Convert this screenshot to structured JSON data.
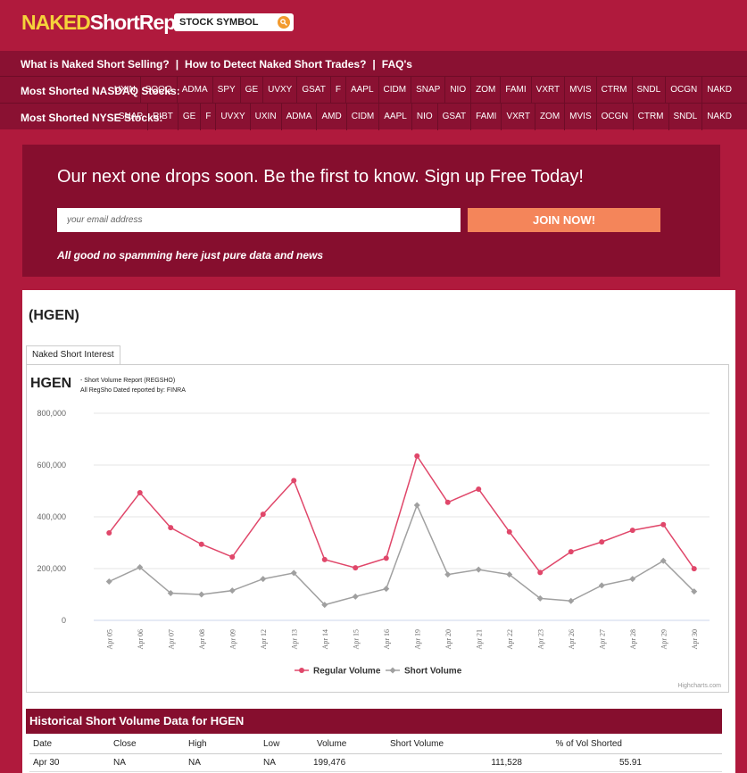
{
  "header": {
    "logo_naked": "NAKED",
    "logo_short": "ShortReport",
    "search_placeholder": "STOCK SYMBOL"
  },
  "nav": {
    "links": [
      "What is Naked Short Selling?",
      "How to Detect Naked Short Trades?",
      "FAQ's"
    ],
    "separator": "|",
    "nasdaq_label": "Most Shorted NASDAQ Stocks:",
    "nasdaq_tickers": [
      "UXIN",
      "SQQQ",
      "ADMA",
      "SPY",
      "GE",
      "UVXY",
      "GSAT",
      "F",
      "AAPL",
      "CIDM",
      "SNAP",
      "NIO",
      "ZOM",
      "FAMI",
      "VXRT",
      "MVIS",
      "CTRM",
      "SNDL",
      "OCGN",
      "NAKD"
    ],
    "nyse_label": "Most Shorted NYSE Stocks:",
    "nyse_tickers": [
      "SNAP",
      "RIBT",
      "GE",
      "F",
      "UVXY",
      "UXIN",
      "ADMA",
      "AMD",
      "CIDM",
      "AAPL",
      "NIO",
      "GSAT",
      "FAMI",
      "VXRT",
      "ZOM",
      "MVIS",
      "OCGN",
      "CTRM",
      "SNDL",
      "NAKD"
    ]
  },
  "signup": {
    "headline": "Our next one drops soon. Be the first to know. Sign up Free Today!",
    "email_placeholder": "your email address",
    "button": "JOIN NOW!",
    "note": "All good no spamming here just pure data and news"
  },
  "main": {
    "title": "(HGEN)",
    "tab": "Naked Short Interest",
    "chart_ticker": "HGEN",
    "chart_sub1": "- Short Volume Report  (REGSHO)",
    "chart_sub2": "All RegSho Dated reported by: FINRA",
    "credit": "Highcharts.com"
  },
  "colors": {
    "background": "#b01a3d",
    "nav": "#8a1132",
    "regular": "#e0476a",
    "short": "#a0a0a0",
    "join": "#f4855a"
  },
  "chart_data": {
    "type": "line",
    "categories": [
      "Apr 05",
      "Apr 06",
      "Apr 07",
      "Apr 08",
      "Apr 09",
      "Apr 12",
      "Apr 13",
      "Apr 14",
      "Apr 15",
      "Apr 16",
      "Apr 19",
      "Apr 20",
      "Apr 21",
      "Apr 22",
      "Apr 23",
      "Apr 26",
      "Apr 27",
      "Apr 28",
      "Apr 29",
      "Apr 30"
    ],
    "ylim": [
      0,
      800000
    ],
    "yticks": [
      0,
      200000,
      400000,
      600000,
      800000
    ],
    "ytick_labels": [
      "0",
      "200,000",
      "400,000",
      "600,000",
      "800,000"
    ],
    "series": [
      {
        "name": "Regular Volume",
        "color": "#e0476a",
        "values": [
          338000,
          493000,
          358000,
          294000,
          245000,
          410000,
          540000,
          235000,
          203000,
          240000,
          635000,
          456000,
          507000,
          342000,
          185000,
          265000,
          303000,
          348000,
          370000,
          199476
        ]
      },
      {
        "name": "Short Volume",
        "color": "#a0a0a0",
        "values": [
          150000,
          205000,
          105000,
          100000,
          115000,
          160000,
          183000,
          60000,
          92000,
          122000,
          445000,
          177000,
          196000,
          177000,
          85000,
          75000,
          135000,
          160000,
          230000,
          111528
        ]
      }
    ],
    "legend": "bottom-center",
    "grid": true
  },
  "table": {
    "title": "Historical Short Volume Data for HGEN",
    "columns": [
      "Date",
      "Close",
      "High",
      "Low",
      "Volume",
      "Short Volume",
      "% of Vol Shorted"
    ],
    "rows": [
      [
        "Apr 30",
        "NA",
        "NA",
        "NA",
        "199,476",
        "111,528",
        "55.91"
      ]
    ]
  }
}
